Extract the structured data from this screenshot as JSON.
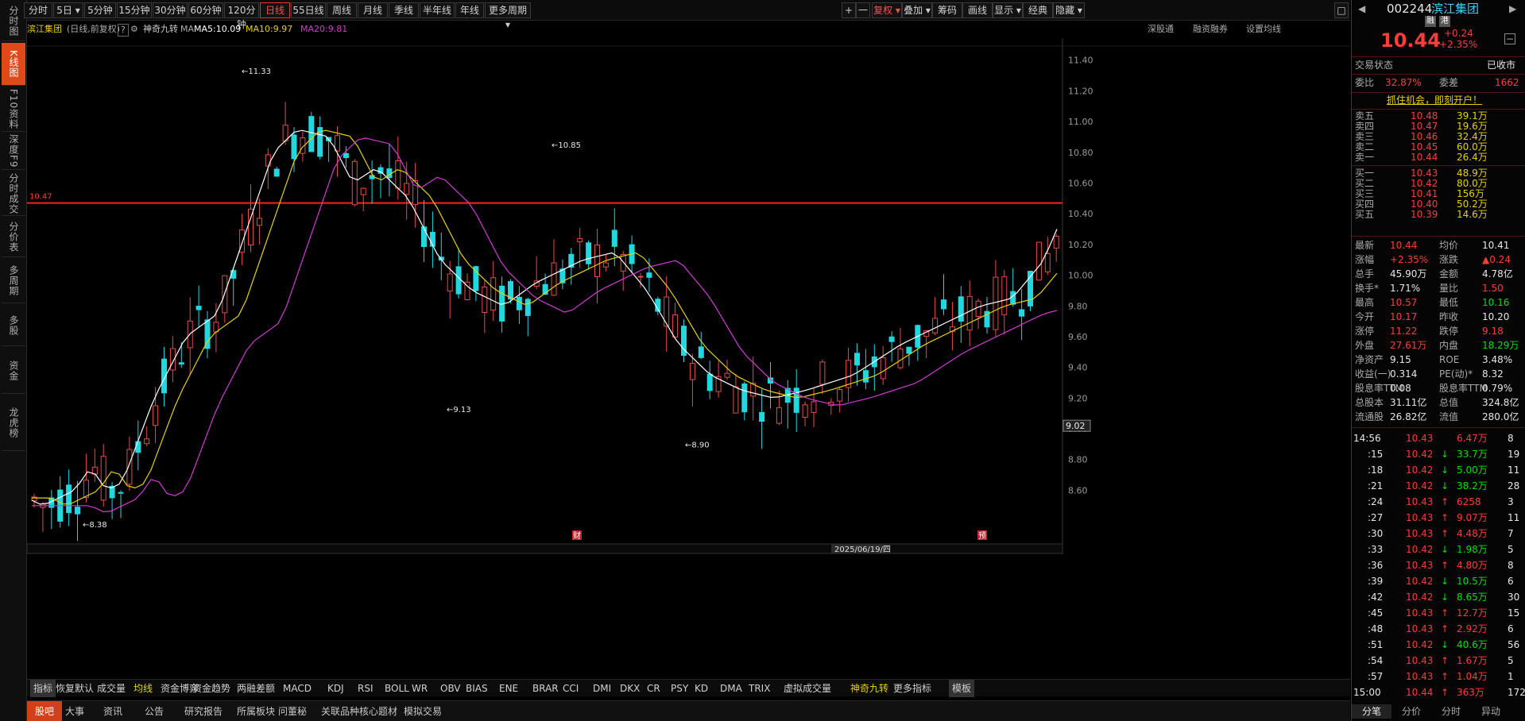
{
  "left_nav": [
    {
      "label": "分时图",
      "active": false
    },
    {
      "label": "K线图",
      "active": true
    },
    {
      "label": "F10资料",
      "active": false
    },
    {
      "label": "深度F9",
      "active": false
    },
    {
      "label": "分时成交",
      "active": false
    },
    {
      "label": "分价表",
      "active": false
    },
    {
      "label": "多周期",
      "active": false
    },
    {
      "label": "多股",
      "active": false
    },
    {
      "label": "资金",
      "active": false
    },
    {
      "label": "龙虎榜",
      "active": false
    }
  ],
  "toolbar": {
    "periods": [
      "分时",
      "5日",
      "5分钟",
      "15分钟",
      "30分钟",
      "60分钟",
      "120分钟",
      "日线",
      "55日线",
      "周线",
      "月线",
      "季线",
      "半年线",
      "年线",
      "更多周期"
    ],
    "active_period": "日线",
    "right": [
      "复权",
      "叠加",
      "筹码",
      "画线",
      "显示",
      "经典",
      "隐藏"
    ],
    "plus": "+",
    "minus": "一",
    "restore": "□"
  },
  "info": {
    "stock_name": "滨江集团",
    "mode": "(日线,前复权)",
    "help": "?",
    "indicator": "神奇九转",
    "ma_label": "MA",
    "ma5": "MA5:10.09",
    "ma10": "MA10:9.97",
    "ma20": "MA20:9.81",
    "links": [
      "深股通",
      "融资融券",
      "设置均线"
    ]
  },
  "chart_data": {
    "type": "candlestick",
    "price_axis": [
      "11.40",
      "11.20",
      "11.00",
      "10.80",
      "10.60",
      "10.40",
      "10.20",
      "10.00",
      "9.80",
      "9.60",
      "9.40",
      "9.20",
      "9.00",
      "8.80",
      "8.60"
    ],
    "ylim": [
      8.38,
      11.45
    ],
    "reference_line": {
      "label": "10.47",
      "value": 10.47
    },
    "current_price_label": "9.02",
    "annotations": [
      {
        "text": "←11.33",
        "value": 11.33
      },
      {
        "text": "←10.85",
        "value": 10.85
      },
      {
        "text": "←9.13",
        "value": 9.13
      },
      {
        "text": "←8.90",
        "value": 8.9
      },
      {
        "text": "←8.38",
        "value": 8.38
      }
    ],
    "event_markers": [
      "财",
      "预"
    ],
    "date_label": "2025/06/19/四",
    "series": [
      {
        "name": "MA5",
        "color": "#ffffff"
      },
      {
        "name": "MA10",
        "color": "#e6d200"
      },
      {
        "name": "MA20",
        "color": "#d23ad2"
      }
    ]
  },
  "indicators": [
    "指标",
    "恢复默认",
    "成交量",
    "均线",
    "资金博弈",
    "资金趋势",
    "两融差额",
    "MACD",
    "KDJ",
    "RSI",
    "BOLL",
    "WR",
    "OBV",
    "BIAS",
    "ENE",
    "BRAR",
    "CCI",
    "DMI",
    "DKX",
    "CR",
    "PSY",
    "KD",
    "DMA",
    "TRIX",
    "虚拟成交量",
    "神奇九转",
    "更多指标",
    "模板"
  ],
  "bottom_tabs": [
    "股吧",
    "大事",
    "资讯",
    "公告",
    "研究报告",
    "所属板块",
    "问董秘",
    "关联品种",
    "核心题材",
    "模拟交易"
  ],
  "quote": {
    "code": "002244",
    "name": "滨江集团",
    "tags": [
      "融",
      "港"
    ],
    "price": "10.44",
    "change": "+0.24",
    "change_pct": "+2.35%",
    "status_label": "交易状态",
    "status": "已收市",
    "weibi_label": "委比",
    "weibi": "32.87%",
    "weicha_label": "委差",
    "weicha": "1662",
    "banner": "抓住机会，即刻开户！",
    "asks": [
      {
        "label": "卖五",
        "price": "10.48",
        "vol": "39.1万"
      },
      {
        "label": "卖四",
        "price": "10.47",
        "vol": "19.6万"
      },
      {
        "label": "卖三",
        "price": "10.46",
        "vol": "32.4万"
      },
      {
        "label": "卖二",
        "price": "10.45",
        "vol": "60.0万"
      },
      {
        "label": "卖一",
        "price": "10.44",
        "vol": "26.4万"
      }
    ],
    "bids": [
      {
        "label": "买一",
        "price": "10.43",
        "vol": "48.9万"
      },
      {
        "label": "买二",
        "price": "10.42",
        "vol": "80.0万"
      },
      {
        "label": "买三",
        "price": "10.41",
        "vol": "156万"
      },
      {
        "label": "买四",
        "price": "10.40",
        "vol": "50.2万"
      },
      {
        "label": "买五",
        "price": "10.39",
        "vol": "14.6万"
      }
    ],
    "stats": [
      [
        "最新",
        "10.44",
        "均价",
        "10.41"
      ],
      [
        "涨幅",
        "+2.35%",
        "涨跌",
        "▲0.24"
      ],
      [
        "总手",
        "45.90万",
        "金额",
        "4.78亿"
      ],
      [
        "换手*",
        "1.71%",
        "量比",
        "1.50"
      ],
      [
        "最高",
        "10.57",
        "最低",
        "10.16"
      ],
      [
        "今开",
        "10.17",
        "昨收",
        "10.20"
      ],
      [
        "涨停",
        "11.22",
        "跌停",
        "9.18"
      ],
      [
        "外盘",
        "27.61万",
        "内盘",
        "18.29万"
      ],
      [
        "净资产",
        "9.15",
        "ROE",
        "3.48%"
      ],
      [
        "收益(一)",
        "0.314",
        "PE(动)*",
        "8.32"
      ],
      [
        "股息率TTM",
        "0.08",
        "股息率TTM",
        "0.79%"
      ],
      [
        "总股本",
        "31.11亿",
        "总值",
        "324.8亿"
      ],
      [
        "流通股",
        "26.82亿",
        "流值",
        "280.0亿"
      ]
    ],
    "ticks": [
      [
        "14:56",
        "10.43",
        "6.47万",
        "",
        "8"
      ],
      [
        ":15",
        "10.42",
        "33.7万",
        "↓",
        "19"
      ],
      [
        ":18",
        "10.42",
        "5.00万",
        "↓",
        "11"
      ],
      [
        ":21",
        "10.42",
        "38.2万",
        "↓",
        "28"
      ],
      [
        ":24",
        "10.43",
        "6258",
        "↑",
        "3"
      ],
      [
        ":27",
        "10.43",
        "9.07万",
        "↑",
        "11"
      ],
      [
        ":30",
        "10.43",
        "4.48万",
        "↑",
        "7"
      ],
      [
        ":33",
        "10.42",
        "1.98万",
        "↓",
        "5"
      ],
      [
        ":36",
        "10.43",
        "4.80万",
        "↑",
        "8"
      ],
      [
        ":39",
        "10.42",
        "10.5万",
        "↓",
        "6"
      ],
      [
        ":42",
        "10.42",
        "8.65万",
        "↓",
        "30"
      ],
      [
        ":45",
        "10.43",
        "12.7万",
        "↑",
        "15"
      ],
      [
        ":48",
        "10.43",
        "2.92万",
        "↑",
        "6"
      ],
      [
        ":51",
        "10.42",
        "40.6万",
        "↓",
        "56"
      ],
      [
        ":54",
        "10.43",
        "1.67万",
        "↑",
        "5"
      ],
      [
        ":57",
        "10.43",
        "1.04万",
        "↑",
        "1"
      ],
      [
        "15:00",
        "10.44",
        "363万",
        "↑",
        "172"
      ]
    ],
    "panel_tabs": [
      "分笔",
      "分价",
      "分时",
      "异动"
    ]
  }
}
